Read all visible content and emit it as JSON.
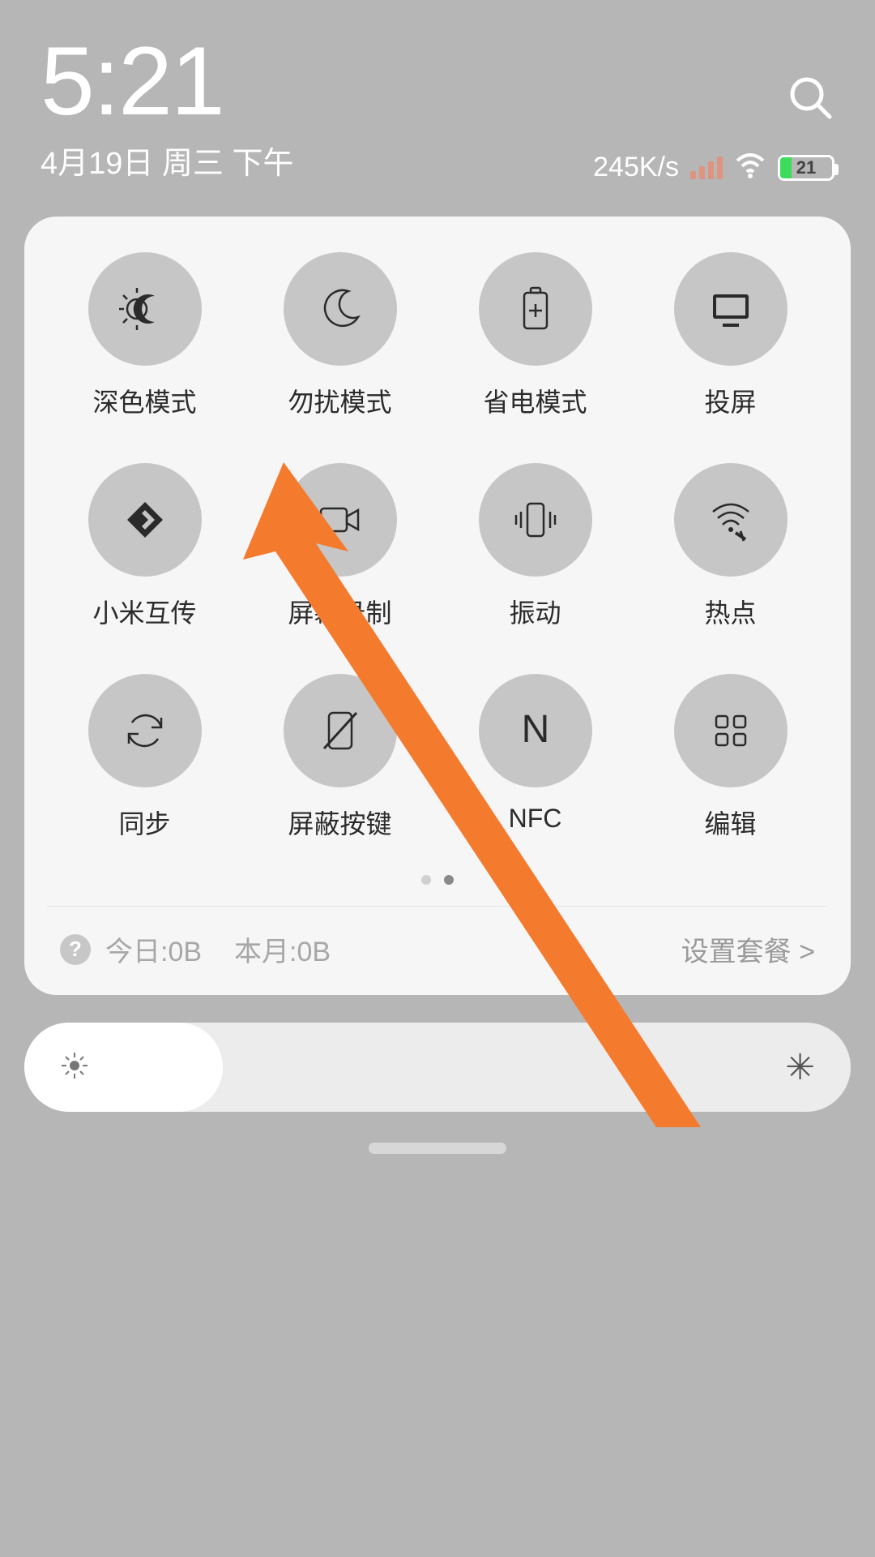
{
  "header": {
    "time": "5:21",
    "date": "4月19日 周三 下午",
    "netspeed": "245K/s",
    "battery_percent": "21"
  },
  "toggles": [
    {
      "id": "dark-mode",
      "label": "深色模式",
      "icon": "dark-mode-icon"
    },
    {
      "id": "dnd",
      "label": "勿扰模式",
      "icon": "moon-icon"
    },
    {
      "id": "battery-saver",
      "label": "省电模式",
      "icon": "battery-plus-icon"
    },
    {
      "id": "cast",
      "label": "投屏",
      "icon": "cast-icon"
    },
    {
      "id": "mi-share",
      "label": "小米互传",
      "icon": "mi-share-icon"
    },
    {
      "id": "screen-record",
      "label": "屏幕录制",
      "icon": "video-record-icon"
    },
    {
      "id": "vibrate",
      "label": "振动",
      "icon": "vibrate-icon"
    },
    {
      "id": "hotspot",
      "label": "热点",
      "icon": "hotspot-icon"
    },
    {
      "id": "sync",
      "label": "同步",
      "icon": "sync-icon"
    },
    {
      "id": "block-keys",
      "label": "屏蔽按键",
      "icon": "block-keys-icon"
    },
    {
      "id": "nfc",
      "label": "NFC",
      "icon": "nfc-icon"
    },
    {
      "id": "edit",
      "label": "编辑",
      "icon": "edit-grid-icon"
    }
  ],
  "data_usage": {
    "today": "今日:0B",
    "month": "本月:0B",
    "plan_link": "设置套餐 >"
  },
  "annotation": {
    "arrow_target": "screen-record"
  }
}
